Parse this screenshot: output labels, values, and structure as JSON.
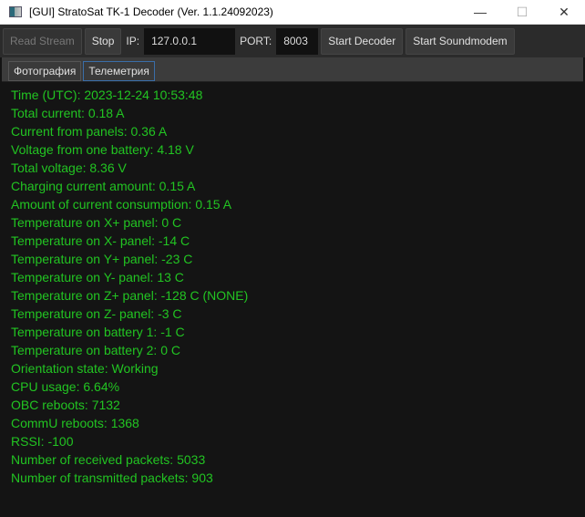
{
  "window": {
    "title": "[GUI] StratoSat TK-1 Decoder (Ver. 1.1.24092023)",
    "minimize": "—",
    "maximize": "☐",
    "close": "✕"
  },
  "toolbar": {
    "read_stream": "Read Stream",
    "stop": "Stop",
    "ip_label": "IP:",
    "ip_value": "127.0.0.1",
    "port_label": "PORT:",
    "port_value": "8003",
    "start_decoder": "Start Decoder",
    "start_soundmodem": "Start Soundmodem"
  },
  "tabs": [
    {
      "label": "Фотография"
    },
    {
      "label": "Телеметрия"
    }
  ],
  "telemetry": [
    "Time (UTC): 2023-12-24 10:53:48",
    "Total current: 0.18 A",
    "Current from panels: 0.36 A",
    "Voltage from one battery: 4.18 V",
    "Total voltage: 8.36 V",
    "Charging current amount: 0.15 A",
    "Amount of current consumption: 0.15 A",
    "Temperature on X+ panel: 0 C",
    "Temperature on X- panel: -14 C",
    "Temperature on Y+ panel: -23 C",
    "Temperature on Y- panel: 13 C",
    "Temperature on Z+ panel: -128 C (NONE)",
    "Temperature on Z- panel: -3 C",
    "Temperature on battery 1: -1 C",
    "Temperature on battery 2: 0 C",
    "Orientation state: Working",
    "CPU usage: 6.64%",
    "OBC reboots: 7132",
    "CommU reboots: 1368",
    "RSSI: -100",
    "Number of received packets: 5033",
    "Number of transmitted packets: 903"
  ]
}
